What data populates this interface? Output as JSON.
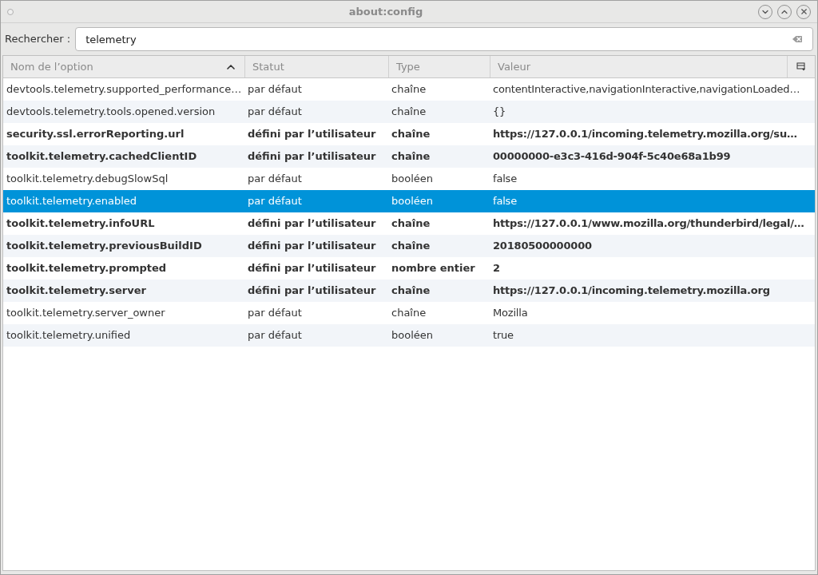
{
  "window": {
    "title": "about:config"
  },
  "search": {
    "label": "Rechercher :",
    "value": "telemetry"
  },
  "columns": [
    {
      "label": "Nom de l’option",
      "sorted": true
    },
    {
      "label": "Statut",
      "sorted": false
    },
    {
      "label": "Type",
      "sorted": false
    },
    {
      "label": "Valeur",
      "sorted": false
    }
  ],
  "rows": [
    {
      "name": "devtools.telemetry.supported_performance…",
      "status": "par défaut",
      "type": "chaîne",
      "value": "contentInteractive,navigationInteractive,navigationLoaded…",
      "modified": false,
      "selected": false
    },
    {
      "name": "devtools.telemetry.tools.opened.version",
      "status": "par défaut",
      "type": "chaîne",
      "value": "{}",
      "modified": false,
      "selected": false
    },
    {
      "name": "security.ssl.errorReporting.url",
      "status": "défini par l’utilisateur",
      "type": "chaîne",
      "value": "https://127.0.0.1/incoming.telemetry.mozilla.org/su…",
      "modified": true,
      "selected": false
    },
    {
      "name": "toolkit.telemetry.cachedClientID",
      "status": "défini par l’utilisateur",
      "type": "chaîne",
      "value": "00000000-e3c3-416d-904f-5c40e68a1b99",
      "modified": true,
      "selected": false
    },
    {
      "name": "toolkit.telemetry.debugSlowSql",
      "status": "par défaut",
      "type": "booléen",
      "value": "false",
      "modified": false,
      "selected": false
    },
    {
      "name": "toolkit.telemetry.enabled",
      "status": "par défaut",
      "type": "booléen",
      "value": "false",
      "modified": false,
      "selected": true
    },
    {
      "name": "toolkit.telemetry.infoURL",
      "status": "défini par l’utilisateur",
      "type": "chaîne",
      "value": "https://127.0.0.1/www.mozilla.org/thunderbird/legal/…",
      "modified": true,
      "selected": false
    },
    {
      "name": "toolkit.telemetry.previousBuildID",
      "status": "défini par l’utilisateur",
      "type": "chaîne",
      "value": "20180500000000",
      "modified": true,
      "selected": false
    },
    {
      "name": "toolkit.telemetry.prompted",
      "status": "défini par l’utilisateur",
      "type": "nombre entier",
      "value": "2",
      "modified": true,
      "selected": false
    },
    {
      "name": "toolkit.telemetry.server",
      "status": "défini par l’utilisateur",
      "type": "chaîne",
      "value": "https://127.0.0.1/incoming.telemetry.mozilla.org",
      "modified": true,
      "selected": false
    },
    {
      "name": "toolkit.telemetry.server_owner",
      "status": "par défaut",
      "type": "chaîne",
      "value": "Mozilla",
      "modified": false,
      "selected": false
    },
    {
      "name": "toolkit.telemetry.unified",
      "status": "par défaut",
      "type": "booléen",
      "value": "true",
      "modified": false,
      "selected": false
    }
  ]
}
